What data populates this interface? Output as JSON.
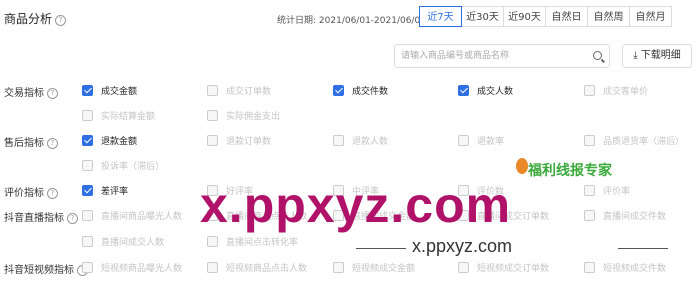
{
  "header": {
    "title": "商品分析",
    "date_label": "统计日期:",
    "date_range": "2021/06/01-2021/06/07",
    "tabs": [
      {
        "label": "近7天",
        "active": true
      },
      {
        "label": "近30天",
        "active": false
      },
      {
        "label": "近90天",
        "active": false
      },
      {
        "label": "自然日",
        "active": false
      },
      {
        "label": "自然周",
        "active": false
      },
      {
        "label": "自然月",
        "active": false
      }
    ]
  },
  "toolbar": {
    "search_placeholder": "请输入商品编号或商品名称",
    "download_label": "下载明细"
  },
  "rows": [
    {
      "label": "交易指标",
      "items": [
        {
          "label": "成交金额",
          "checked": true
        },
        {
          "label": "成交订单数",
          "checked": false
        },
        {
          "label": "成交件数",
          "checked": true
        },
        {
          "label": "成交人数",
          "checked": true
        },
        {
          "label": "成交客单价",
          "checked": false
        }
      ],
      "items2": [
        {
          "label": "实际结算金额",
          "checked": false
        },
        {
          "label": "实际佣金支出",
          "checked": false
        }
      ]
    },
    {
      "label": "售后指标",
      "items": [
        {
          "label": "退款金额",
          "checked": true
        },
        {
          "label": "退款订单数",
          "checked": false
        },
        {
          "label": "退款人数",
          "checked": false
        },
        {
          "label": "退款率",
          "checked": false
        },
        {
          "label": "品质退货率（滞后）",
          "checked": false
        }
      ],
      "items2": [
        {
          "label": "投诉率（滞后）",
          "checked": false
        }
      ]
    },
    {
      "label": "评价指标",
      "items": [
        {
          "label": "差评率",
          "checked": true
        },
        {
          "label": "好评率",
          "checked": false
        },
        {
          "label": "中评率",
          "checked": false
        },
        {
          "label": "评价数",
          "checked": false
        },
        {
          "label": "评价率",
          "checked": false
        }
      ]
    },
    {
      "label": "抖音直播指标",
      "items": [
        {
          "label": "直播间商品曝光人数",
          "checked": false
        },
        {
          "label": "直播间商品点击人数",
          "checked": false
        },
        {
          "label": "直播间成交金额",
          "checked": false
        },
        {
          "label": "直播间成交订单数",
          "checked": false
        },
        {
          "label": "直播间成交件数",
          "checked": false
        }
      ],
      "items2": [
        {
          "label": "直播间成交人数",
          "checked": false
        },
        {
          "label": "直播间点击转化率",
          "checked": false
        }
      ]
    },
    {
      "label": "抖音短视频指标",
      "items": [
        {
          "label": "短视频商品曝光人数",
          "checked": false
        },
        {
          "label": "短视频商品点击人数",
          "checked": false
        },
        {
          "label": "短视频成交金额",
          "checked": false
        },
        {
          "label": "短视频成交订单数",
          "checked": false
        },
        {
          "label": "短视频成交件数",
          "checked": false
        }
      ]
    }
  ],
  "watermark": {
    "main": "x.ppxyz.com",
    "sub": "x.ppxyz.com",
    "brand": "福利线报专家"
  },
  "colors": {
    "accent": "#2f6fe4",
    "watermark": "#b0126a",
    "brand": "#3aa93a"
  }
}
